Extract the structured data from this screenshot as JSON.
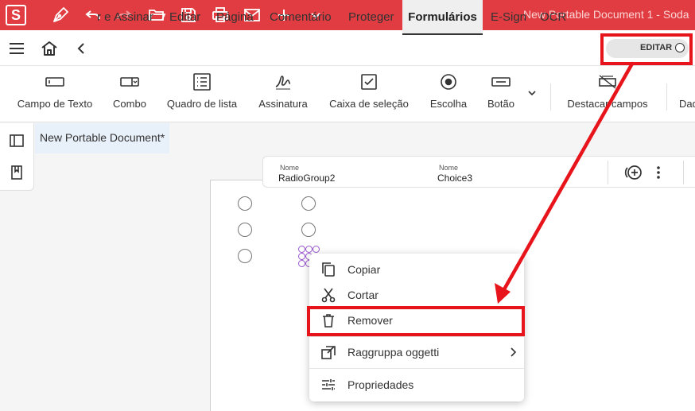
{
  "app": {
    "logo_letter": "S",
    "document_title": "New Portable Document 1  -  Soda"
  },
  "menu": {
    "tabs": [
      {
        "label": "r e Assinar"
      },
      {
        "label": "Editar"
      },
      {
        "label": "Página"
      },
      {
        "label": "Comentário"
      },
      {
        "label": "Proteger"
      },
      {
        "label": "Formulários",
        "active": true
      },
      {
        "label": "E-Sign"
      },
      {
        "label": "OCR"
      }
    ],
    "edit_toggle_label": "EDITAR"
  },
  "ribbon": {
    "buttons": [
      {
        "label": "Campo de Texto",
        "icon": "text-field-icon"
      },
      {
        "label": "Combo",
        "icon": "combo-box-icon"
      },
      {
        "label": "Quadro de lista",
        "icon": "list-box-icon"
      },
      {
        "label": "Assinatura",
        "icon": "signature-icon"
      },
      {
        "label": "Caixa de seleção",
        "icon": "checkbox-icon"
      },
      {
        "label": "Escolha",
        "icon": "radio-choice-icon"
      },
      {
        "label": "Botão",
        "icon": "button-icon"
      },
      {
        "label": "Destacar campos",
        "icon": "highlight-fields-icon"
      },
      {
        "label": "Dad",
        "icon": "data-icon"
      }
    ]
  },
  "document": {
    "tab_label": "New Portable Document*"
  },
  "properties": [
    {
      "caption": "Nome",
      "value": "RadioGroup2"
    },
    {
      "caption": "Nome",
      "value": "Choice3"
    }
  ],
  "context_menu": {
    "items": [
      {
        "label": "Copiar",
        "icon": "copy-icon"
      },
      {
        "label": "Cortar",
        "icon": "scissors-icon"
      },
      {
        "label": "Remover",
        "icon": "trash-icon"
      },
      {
        "label": "Raggruppa oggetti",
        "icon": "group-objects-icon"
      },
      {
        "label": "Propriedades",
        "icon": "sliders-icon"
      }
    ]
  },
  "colors": {
    "brand": "#e03c41",
    "annotation": "#e8141b",
    "selection": "#9b59d0"
  }
}
